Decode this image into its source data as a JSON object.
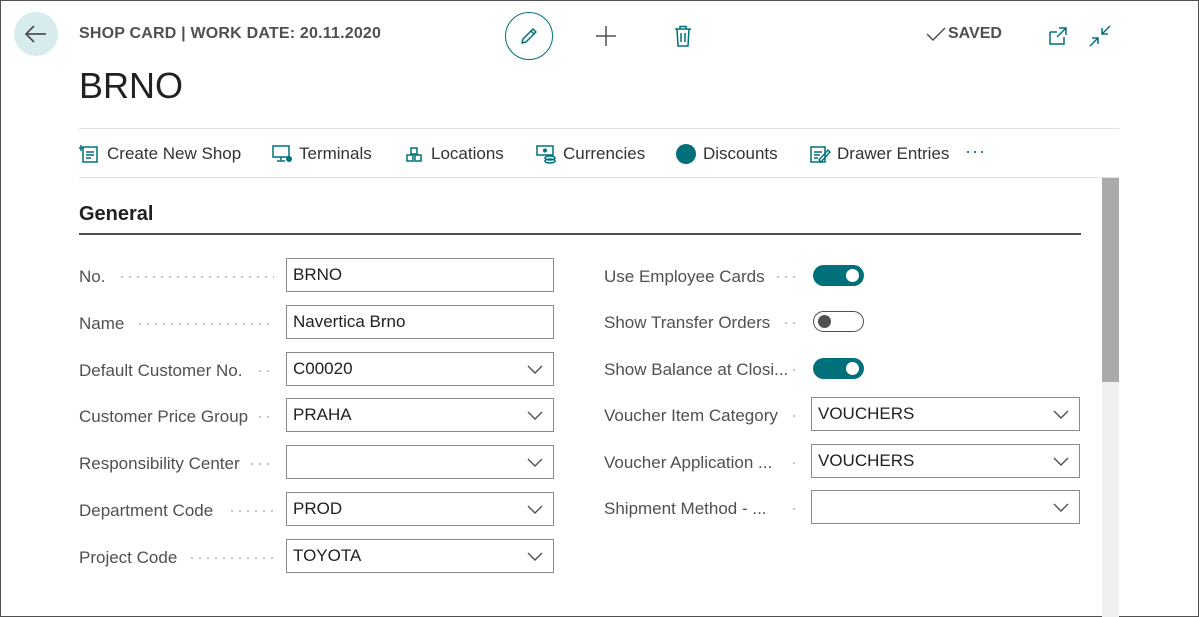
{
  "header": {
    "caption": "SHOP CARD | WORK DATE: 20.11.2020",
    "title": "BRNO",
    "saved_label": "SAVED"
  },
  "actions": [
    {
      "label": "Create New Shop",
      "icon": "create-shop-icon"
    },
    {
      "label": "Terminals",
      "icon": "terminal-icon"
    },
    {
      "label": "Locations",
      "icon": "locations-icon"
    },
    {
      "label": "Currencies",
      "icon": "currencies-icon"
    },
    {
      "label": "Discounts",
      "icon": "discounts-icon"
    },
    {
      "label": "Drawer Entries",
      "icon": "drawer-entries-icon"
    }
  ],
  "more_label": "···",
  "section": {
    "title": "General"
  },
  "left_fields": [
    {
      "label": "No.",
      "value": "BRNO",
      "dropdown": false
    },
    {
      "label": "Name",
      "value": "Navertica Brno",
      "dropdown": false
    },
    {
      "label": "Default Customer No.",
      "value": "C00020",
      "dropdown": true
    },
    {
      "label": "Customer Price Group",
      "value": "PRAHA",
      "dropdown": true
    },
    {
      "label": "Responsibility Center",
      "value": "",
      "dropdown": true
    },
    {
      "label": "Department Code",
      "value": "PROD",
      "dropdown": true
    },
    {
      "label": "Project Code",
      "value": "TOYOTA",
      "dropdown": true
    }
  ],
  "right_toggles": [
    {
      "label": "Use Employee Cards",
      "on": true
    },
    {
      "label": "Show Transfer Orders",
      "on": false
    },
    {
      "label": "Show Balance at Closi...",
      "on": true
    }
  ],
  "right_fields": [
    {
      "label": "Voucher Item Category",
      "value": "VOUCHERS",
      "dropdown": true
    },
    {
      "label": "Voucher Application ...",
      "value": "VOUCHERS",
      "dropdown": true
    },
    {
      "label": "Shipment Method - ...",
      "value": "",
      "dropdown": true
    }
  ],
  "colors": {
    "accent": "#00707a",
    "back_button_bg": "#d8ecef"
  }
}
